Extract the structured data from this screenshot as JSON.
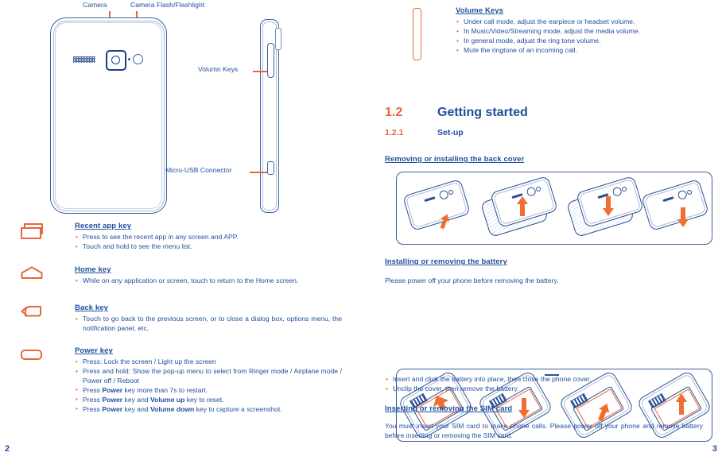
{
  "document": {
    "left_page_number": "2",
    "right_page_number": "3",
    "colors": {
      "blue": "#1f4e9c",
      "orange": "#e8663a",
      "line_blue": "#3a5f9e"
    }
  },
  "left_page": {
    "diagram": {
      "labels": {
        "camera": "Camera",
        "camera_flash": "Camera Flash/Flashlight",
        "volume_keys": "Volumn Keys",
        "micro_usb": "Micro-USB Connector"
      },
      "icon_names": {
        "back_view": "phone-back-view",
        "side_view": "phone-side-view",
        "speaker": "speaker-grill-icon",
        "camera": "camera-lens-icon",
        "flash": "camera-flash-icon",
        "volume": "volume-button-icon",
        "usb": "micro-usb-port-icon"
      }
    },
    "keys": [
      {
        "icon": "recent-app-key-icon",
        "title": "Recent app key",
        "bullets": [
          [
            {
              "t": "Press to see the recent app in any screen and APP.",
              "b": false
            }
          ],
          [
            {
              "t": "Touch and hold to see the menu list.",
              "b": false
            }
          ]
        ]
      },
      {
        "icon": "home-key-icon",
        "title": "Home key",
        "bullets": [
          [
            {
              "t": "While on any application or screen, touch to return to the Home screen.",
              "b": false
            }
          ]
        ]
      },
      {
        "icon": "back-key-icon",
        "title": "Back key",
        "bullets": [
          [
            {
              "t": "Touch to go back to the previous screen, or to close a dialog box, options menu, the notification panel, etc.",
              "b": false
            }
          ]
        ]
      },
      {
        "icon": "power-key-icon",
        "title": "Power key",
        "bullets": [
          [
            {
              "t": "Press: Lock the screen / Light up the screen",
              "b": false
            }
          ],
          [
            {
              "t": "Press and hold: Show the pop-up menu to select from Ringer mode / Airplane mode / Power off / Reboot",
              "b": false
            }
          ],
          [
            {
              "t": "Press ",
              "b": false
            },
            {
              "t": "Power",
              "b": true
            },
            {
              "t": " key more than 7s to restart.",
              "b": false
            }
          ],
          [
            {
              "t": "Press ",
              "b": false
            },
            {
              "t": "Power",
              "b": true
            },
            {
              "t": " key and ",
              "b": false
            },
            {
              "t": "Volume up",
              "b": true
            },
            {
              "t": " key to reset.",
              "b": false
            }
          ],
          [
            {
              "t": "Press ",
              "b": false
            },
            {
              "t": "Power",
              "b": true
            },
            {
              "t": " key and ",
              "b": false
            },
            {
              "t": "Volume down",
              "b": true
            },
            {
              "t": " key to capture a screenshot.",
              "b": false
            }
          ]
        ]
      }
    ]
  },
  "right_page": {
    "volume_keys": {
      "icon": "volume-key-glyph",
      "title": "Volume Keys ",
      "bullets": [
        "Under call mode, adjust the earpiece or headset volume.",
        "In Music/Video/Streaming mode, adjust the media volume.",
        "In general mode, adjust the ring tone volume.",
        "Mute the ringtone of an incoming call."
      ]
    },
    "section": {
      "number": "1.2",
      "title": "Getting started"
    },
    "subsection": {
      "number": "1.2.1",
      "title": "Set-up"
    },
    "back_cover": {
      "heading": "Removing or installing the back cover",
      "figure_name": "back-cover-steps-figure",
      "steps": [
        "unclip-cover",
        "lift-cover-off",
        "place-cover-on",
        "press-cover-down"
      ]
    },
    "battery": {
      "heading": "Installing or removing the battery",
      "intro": "Please power off your phone before removing the battery.",
      "figure_name": "battery-steps-figure",
      "steps": [
        "slide-battery-in",
        "push-battery-down",
        "lift-battery-edge",
        "remove-battery"
      ],
      "bullets": [
        "Insert and click the battery into place, then close the phone cover.",
        "Unclip the cover, then remove the battery."
      ]
    },
    "sim": {
      "heading": "Inserting or removing the SIM card",
      "paragraph": "You must insert your SIM card to make phone calls. Please power off your phone and remove battery before inserting or removing the SIM card."
    }
  }
}
